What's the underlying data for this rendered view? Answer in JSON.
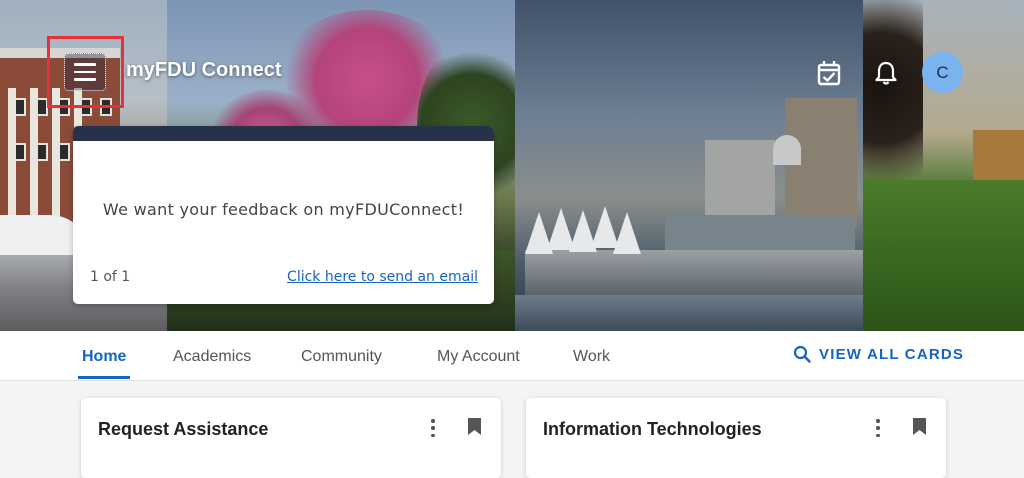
{
  "header": {
    "app_title": "myFDU Connect",
    "menu_icon": "hamburger-menu-icon",
    "calendar_icon": "calendar-check-icon",
    "notifications_icon": "bell-icon",
    "avatar_initial": "C"
  },
  "feedback_card": {
    "message": "We want your feedback on myFDUConnect!",
    "pager": "1 of 1",
    "link_text": "Click here to send an email"
  },
  "nav": {
    "tabs": [
      {
        "label": "Home",
        "active": true
      },
      {
        "label": "Academics",
        "active": false
      },
      {
        "label": "Community",
        "active": false
      },
      {
        "label": "My Account",
        "active": false
      },
      {
        "label": "Work",
        "active": false
      }
    ],
    "view_all_label": "VIEW ALL CARDS"
  },
  "cards": [
    {
      "title": "Request Assistance"
    },
    {
      "title": "Information Technologies"
    }
  ],
  "colors": {
    "accent": "#1565c0",
    "highlight": "#e8303a",
    "card_header": "#27324a",
    "avatar_bg": "#7ab4f0"
  }
}
